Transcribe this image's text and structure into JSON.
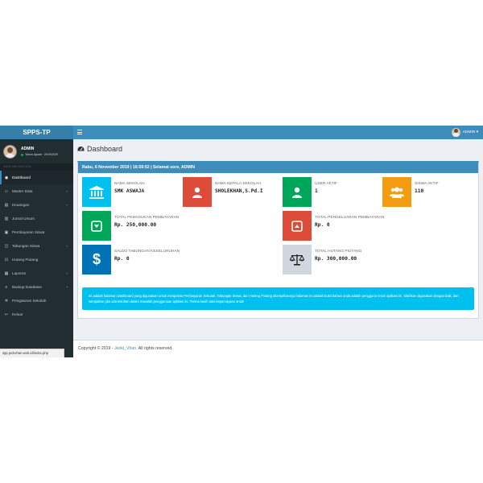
{
  "app": {
    "logo": "SPPS-TP"
  },
  "user": {
    "name": "ADMIN",
    "sub": "Tahun Ajaran : 2019/2020"
  },
  "sidebar": {
    "header": "MAIN NAVIGATION",
    "items": [
      {
        "label": "Dashboard",
        "icon": "dashboard-icon",
        "glyph": "◉"
      },
      {
        "label": "Master Data",
        "icon": "folder-icon",
        "glyph": "▭",
        "chevron": "‹"
      },
      {
        "label": "Keuangan",
        "icon": "money-icon",
        "glyph": "▤",
        "chevron": "‹"
      },
      {
        "label": "Jurnal Umum",
        "icon": "book-icon",
        "glyph": "▥"
      },
      {
        "label": "Pembayaran Siswa",
        "icon": "payment-icon",
        "glyph": "▣"
      },
      {
        "label": "Tabungan Siswa",
        "icon": "savings-icon",
        "glyph": "◫",
        "chevron": "‹"
      },
      {
        "label": "Hutang Piutang",
        "icon": "handshake-icon",
        "glyph": "⊡"
      },
      {
        "label": "Laporan",
        "icon": "report-icon",
        "glyph": "▦",
        "chevron": "‹"
      },
      {
        "label": "Backup Database",
        "icon": "database-icon",
        "glyph": "≡",
        "chevron": "‹"
      },
      {
        "label": "Pengaturan Sekolah",
        "icon": "gear-icon",
        "glyph": "✲"
      },
      {
        "label": "Keluar",
        "icon": "logout-icon",
        "glyph": "↩"
      }
    ]
  },
  "topnav": {
    "user_label": "ADMIN ▾"
  },
  "page": {
    "title": "Dashboard"
  },
  "box": {
    "header": "Rabu, 6 November 2019 | 16:59:52 | Selamat sore, ADMIN"
  },
  "cards": {
    "nama_sekolah": {
      "label": "NAMA SEKOLAH",
      "value": "SMK ASWAJA",
      "color": "#00c0ef"
    },
    "kepala_sekolah": {
      "label": "NAMA KEPALA SEKOLAH",
      "value": "SHOLEKHAN,S.Pd.I",
      "color": "#dd4b39"
    },
    "user_aktif": {
      "label": "USER AKTIF",
      "value": "1",
      "color": "#00a65a"
    },
    "siswa_aktif": {
      "label": "SISWA AKTIF",
      "value": "110",
      "color": "#f39c12"
    },
    "pemasukan": {
      "label": "TOTAL PEMASUKAN PEMBAYARAN",
      "value": "Rp. 250,000.00",
      "color": "#00a65a"
    },
    "pengeluaran": {
      "label": "TOTAL PENGELUARAN PEMBAYARAN",
      "value": "Rp. 0",
      "color": "#dd4b39"
    },
    "tabungan": {
      "label": "SALDO TABUNGAN KESELURUHAN",
      "value": "Rp. 0",
      "color": "#0073b7"
    },
    "hutang": {
      "label": "TOTAL HUTANG PIUTANG",
      "value": "Rp. 300,000.00",
      "color": "#d2d6de"
    }
  },
  "callout": {
    "text": "Ini adalah halaman Dashboard yang digunakan untuk mengelola Pembayaran Sekolah, Tabungan Siswa, dan Hutang Piutang ditampilkannya halaman ini adalah bukti bahwa anda adalah pengguna resmi aplikasi ini. Silahkan digunakan dengan baik, dan sampaikan jika ada keluhan dalam masalah penggunaan aplikasi ini. Terima kasih atas kepercayaan anda!"
  },
  "footer": {
    "prefix": "Copyright © 2019 - ",
    "author": "Jeoki_Vhan.",
    "suffix": " All rights reserved."
  },
  "status_url": "spp.jeckvhan.web.id/index.php"
}
